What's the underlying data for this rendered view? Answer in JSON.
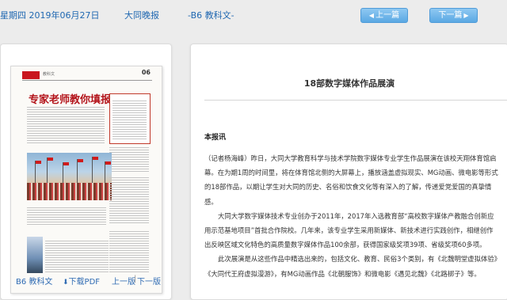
{
  "header": {
    "date": "星期四 2019年06月27日",
    "paper": "大同晚报",
    "edition": "-B6 教科文-",
    "prev_label": "上一篇",
    "next_label": "下一篇"
  },
  "thumbnail": {
    "masthead": "大同晚报",
    "section": "教科文",
    "page": "06",
    "headline": "专家老师教你填报技巧"
  },
  "footer": {
    "edition": "B6 教科文",
    "download": "下载PDF",
    "prev_page": "上一版",
    "sep": "|",
    "next_page": "下一版"
  },
  "article": {
    "title": "18部数字媒体作品展演",
    "byline": "本报讯",
    "paragraphs": [
      "（记者杨海峰）昨日，大同大学教育科学与技术学院数字媒体专业学生作品展演在该校天翔体育馆启幕。在为期1周的时间里，将在体育馆北侧的大屏幕上，播放涵盖虚拟现实、MG动画、微电影等形式的18部作品，以期让学生对大同的历史、名俗和饮食文化等有深入的了解，传递爱党爱国的真挚情感。",
      "大同大学数字媒体技术专业创办于2011年，2017年入选教育部“高校数字媒体产教融合创新应用示范基地项目”首批合作院校。几年来，该专业学生采用新媒体、新技术进行实践创作，相继创作出反映区域文化特色的高质量数字媒体作品100余部，获得国家级奖项39项、省级奖项60多项。",
      "此次展演是从这些作品中精选出来的，包括文化、教育、民俗3个类别，有《北魏明堂虚拟体验》《大同代王府虚拟漫游》，有MG动画作品《北朝服饰》和微电影《遇见北魏》《北路梆子》等。"
    ]
  }
}
